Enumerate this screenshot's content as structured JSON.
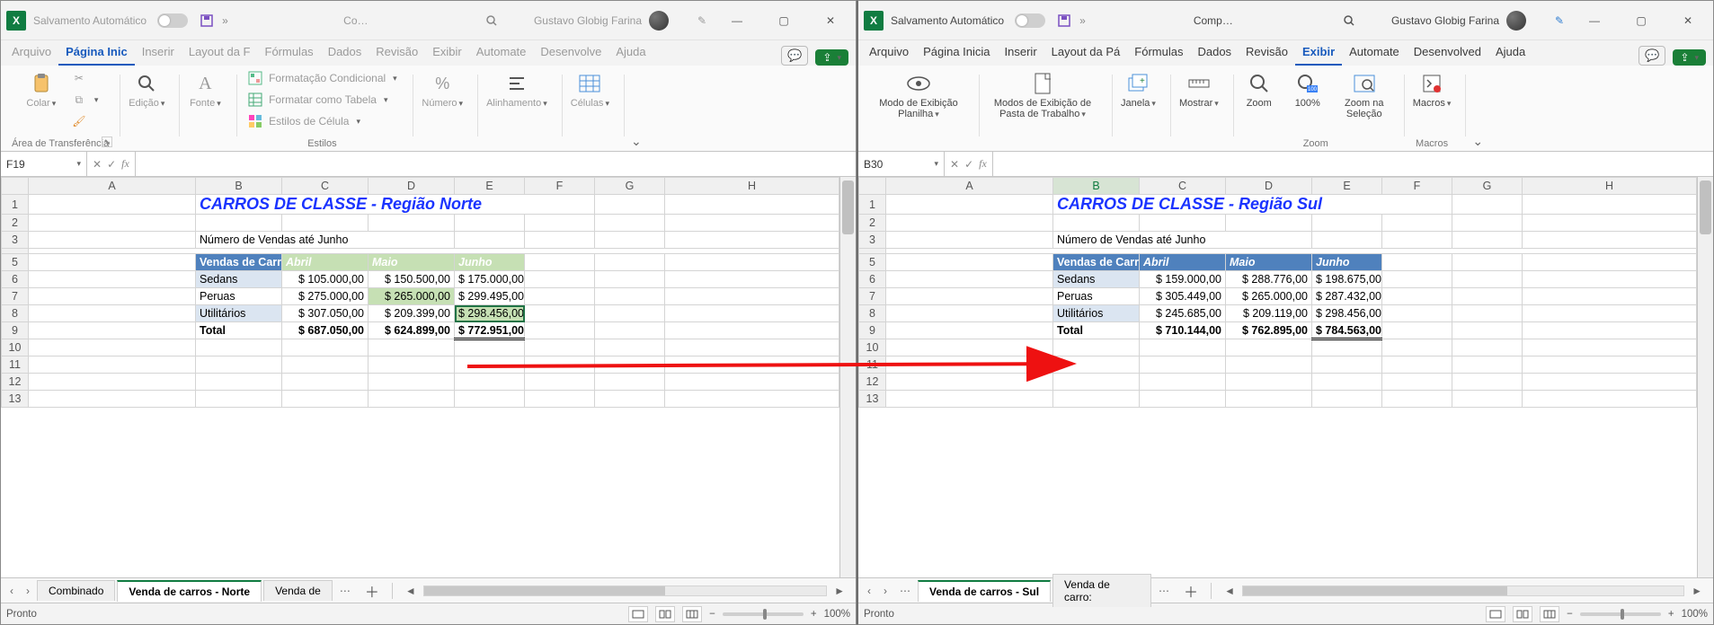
{
  "left": {
    "autosave_label": "Salvamento Automático",
    "title_doc": "Co…",
    "user": "Gustavo Globig Farina",
    "menu": {
      "arquivo": "Arquivo",
      "pagina": "Página Inic",
      "inserir": "Inserir",
      "layout": "Layout da F",
      "formulas": "Fórmulas",
      "dados": "Dados",
      "revisao": "Revisão",
      "exibir": "Exibir",
      "automate": "Automate",
      "desenvolve": "Desenvolve",
      "ajuda": "Ajuda"
    },
    "ribbon": {
      "colar": "Colar",
      "clip": "Área de Transferência",
      "edicao": "Edição",
      "fonte": "Fonte",
      "fmt_cond": "Formatação Condicional",
      "fmt_tab": "Formatar como Tabela",
      "estilos_cel": "Estilos de Célula",
      "estilos": "Estilos",
      "numero": "Número",
      "alinh": "Alinhamento",
      "cel": "Células"
    },
    "namebox": "F19",
    "title": "CARROS DE CLASSE - Região Norte",
    "subtitle": "Número de Vendas até Junho",
    "headers": {
      "h0": "Vendas de Carros Usados",
      "h1": "Abril",
      "h2": "Maio",
      "h3": "Junho"
    },
    "rows": {
      "r1": {
        "label": "Sedans",
        "c": "$ 105.000,00",
        "d": "$ 150.500,00",
        "e": "$ 175.000,00"
      },
      "r2": {
        "label": "Peruas",
        "c": "$ 275.000,00",
        "d": "$ 265.000,00",
        "e": "$ 299.495,00"
      },
      "r3": {
        "label": "Utilitários",
        "c": "$ 307.050,00",
        "d": "$ 209.399,00",
        "e": "$ 298.456,00"
      },
      "r4": {
        "label": "Total",
        "c": "$ 687.050,00",
        "d": "$ 624.899,00",
        "e": "$ 772.951,00"
      }
    },
    "tabs": {
      "t1": "Combinado",
      "t2": "Venda de carros - Norte",
      "t3": "Venda de"
    },
    "status": {
      "ready": "Pronto",
      "zoom": "100%"
    }
  },
  "right": {
    "autosave_label": "Salvamento Automático",
    "title_doc": "Comp…",
    "user": "Gustavo Globig Farina",
    "menu": {
      "arquivo": "Arquivo",
      "pagina": "Página Inicia",
      "inserir": "Inserir",
      "layout": "Layout da Pá",
      "formulas": "Fórmulas",
      "dados": "Dados",
      "revisao": "Revisão",
      "exibir": "Exibir",
      "automate": "Automate",
      "desenvolve": "Desenvolved",
      "ajuda": "Ajuda"
    },
    "ribbon": {
      "modo": "Modo de Exibição Planilha",
      "modos": "Modos de Exibição de Pasta de Trabalho",
      "janela": "Janela",
      "mostrar": "Mostrar",
      "zoom": "Zoom",
      "z100": "100%",
      "zsel": "Zoom na Seleção",
      "zoom_g": "Zoom",
      "macros": "Macros",
      "macros_g": "Macros"
    },
    "namebox": "B30",
    "title": "CARROS DE CLASSE - Região Sul",
    "subtitle": "Número de Vendas até Junho",
    "headers": {
      "h0": "Vendas de Carros Usados",
      "h1": "Abril",
      "h2": "Maio",
      "h3": "Junho"
    },
    "rows": {
      "r1": {
        "label": "Sedans",
        "c": "$ 159.000,00",
        "d": "$ 288.776,00",
        "e": "$ 198.675,00"
      },
      "r2": {
        "label": "Peruas",
        "c": "$ 305.449,00",
        "d": "$ 265.000,00",
        "e": "$ 287.432,00"
      },
      "r3": {
        "label": "Utilitários",
        "c": "$ 245.685,00",
        "d": "$ 209.119,00",
        "e": "$ 298.456,00"
      },
      "r4": {
        "label": "Total",
        "c": "$ 710.144,00",
        "d": "$ 762.895,00",
        "e": "$ 784.563,00"
      }
    },
    "tabs": {
      "t1": "Venda de carros - Sul",
      "t2": "Venda de carro:"
    },
    "status": {
      "ready": "Pronto",
      "zoom": "100%"
    }
  },
  "cols": {
    "A": "A",
    "B": "B",
    "C": "C",
    "D": "D",
    "E": "E",
    "F": "F",
    "G": "G",
    "H": "H"
  },
  "rownums": {
    "1": "1",
    "2": "2",
    "3": "3",
    "5": "5",
    "6": "6",
    "7": "7",
    "8": "8",
    "9": "9",
    "10": "10",
    "11": "11",
    "12": "12",
    "13": "13"
  }
}
